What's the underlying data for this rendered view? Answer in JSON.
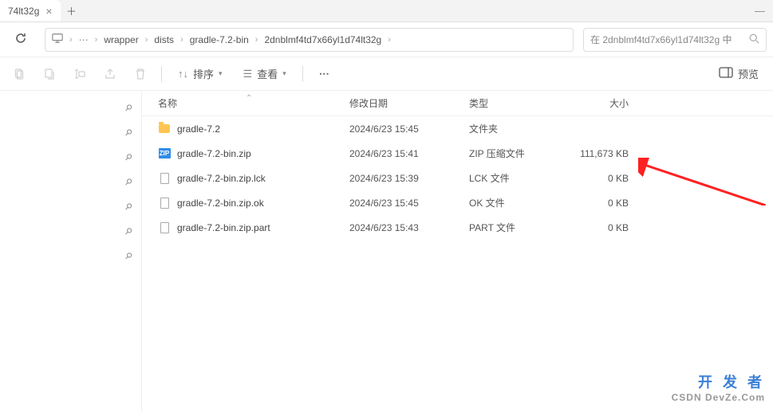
{
  "tab": {
    "title": "74lt32g"
  },
  "breadcrumb": {
    "items": [
      "wrapper",
      "dists",
      "gradle-7.2-bin",
      "2dnblmf4td7x66yl1d74lt32g"
    ]
  },
  "search": {
    "placeholder": "在 2dnblmf4td7x66yl1d74lt32g 中"
  },
  "actions": {
    "sort_label": "排序",
    "view_label": "查看",
    "preview_label": "预览"
  },
  "columns": {
    "name": "名称",
    "date": "修改日期",
    "type": "类型",
    "size": "大小"
  },
  "files": [
    {
      "icon": "folder",
      "name": "gradle-7.2",
      "date": "2024/6/23 15:45",
      "type": "文件夹",
      "size": ""
    },
    {
      "icon": "zip",
      "name": "gradle-7.2-bin.zip",
      "date": "2024/6/23 15:41",
      "type": "ZIP 压缩文件",
      "size": "111,673 KB"
    },
    {
      "icon": "doc",
      "name": "gradle-7.2-bin.zip.lck",
      "date": "2024/6/23 15:39",
      "type": "LCK 文件",
      "size": "0 KB"
    },
    {
      "icon": "doc",
      "name": "gradle-7.2-bin.zip.ok",
      "date": "2024/6/23 15:45",
      "type": "OK 文件",
      "size": "0 KB"
    },
    {
      "icon": "doc",
      "name": "gradle-7.2-bin.zip.part",
      "date": "2024/6/23 15:43",
      "type": "PART 文件",
      "size": "0 KB"
    }
  ],
  "watermark": {
    "line1": "开 发 者",
    "line2": "CSDN DevZe.Com"
  }
}
